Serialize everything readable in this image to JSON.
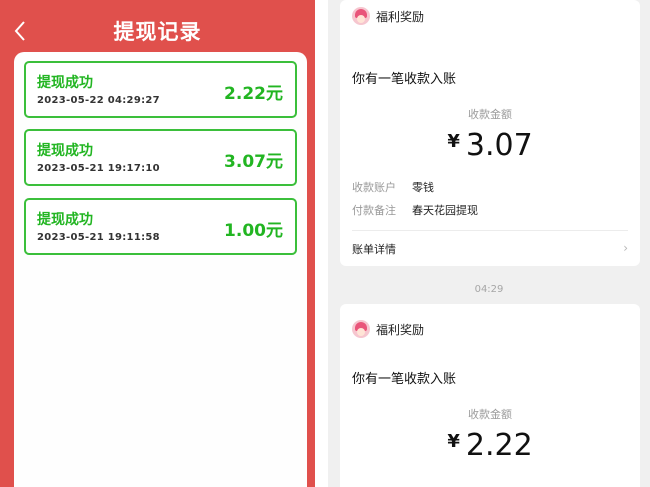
{
  "left": {
    "title": "提现记录",
    "records": [
      {
        "status": "提现成功",
        "time": "2023-05-22  04:29:27",
        "amount": "2.22元"
      },
      {
        "status": "提现成功",
        "time": "2023-05-21  19:17:10",
        "amount": "3.07元"
      },
      {
        "status": "提现成功",
        "time": "2023-05-21  19:11:58",
        "amount": "1.00元"
      }
    ]
  },
  "right": {
    "notices": [
      {
        "sender": "福利奖励",
        "headline": "你有一笔收款入账",
        "amount_label": "收款金额",
        "currency": "¥",
        "amount": "3.07",
        "account_key": "收款账户",
        "account_val": "零钱",
        "remark_key": "付款备注",
        "remark_val": "春天花园提现",
        "details": "账单详情"
      },
      {
        "sender": "福利奖励",
        "headline": "你有一笔收款入账",
        "amount_label": "收款金额",
        "currency": "¥",
        "amount": "2.22"
      }
    ],
    "timestamp": "04:29"
  },
  "colors": {
    "brand_red": "#e0504c",
    "success_green": "#22b522"
  }
}
